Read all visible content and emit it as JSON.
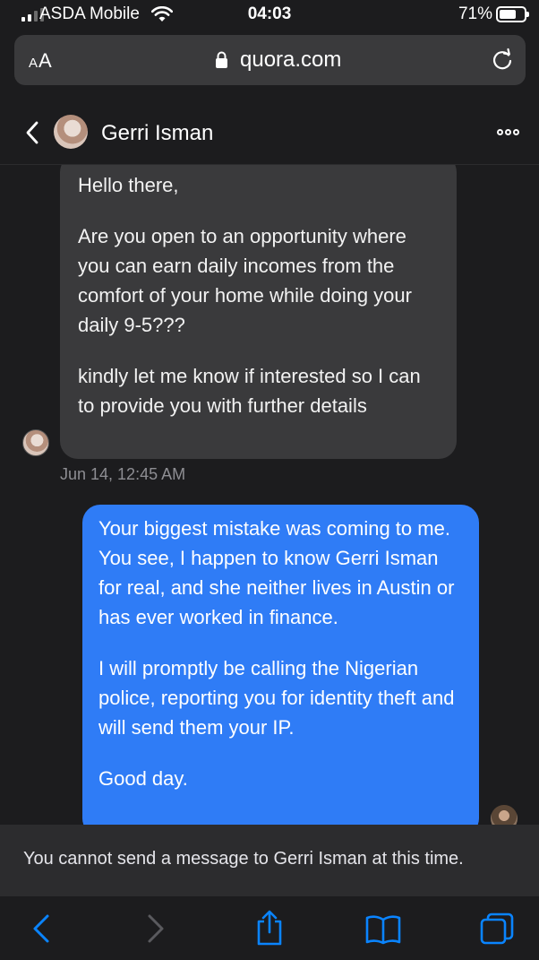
{
  "status_bar": {
    "carrier": "ASDA Mobile",
    "time": "04:03",
    "battery_pct": "71%",
    "battery_level": 0.71,
    "signal_bars": 4,
    "signal_active": 2
  },
  "browser": {
    "reader_label": "AA",
    "url": "quora.com",
    "icons": [
      "lock-icon",
      "reload-icon"
    ]
  },
  "chat": {
    "contact_name": "Gerri Isman",
    "incoming": {
      "paragraphs": [
        "Hello there,",
        "Are you open to an opportunity where you can earn daily incomes from the comfort of your home while doing your daily 9-5???",
        "kindly let me know if interested so I can to provide you with further details"
      ],
      "timestamp": "Jun 14, 12:45 AM"
    },
    "outgoing": {
      "paragraphs": [
        "Your biggest mistake was coming to me. You see, I happen to know Gerri Isman for real, and she neither lives in Austin or has ever worked in finance.",
        "I will promptly be calling the Nigerian police, reporting you for identity theft and will send them your IP.",
        "Good day."
      ]
    },
    "notice": "You cannot send a message to Gerri Isman at this time."
  },
  "toolbar": {
    "icons": [
      "back-arrow-icon",
      "forward-arrow-icon",
      "share-icon",
      "bookmarks-icon",
      "tabs-icon"
    ]
  },
  "colors": {
    "background": "#1c1c1e",
    "incoming_bubble": "#3a3a3c",
    "outgoing_bubble": "#2f7cf6",
    "toolbar_accent": "#0a84ff"
  }
}
